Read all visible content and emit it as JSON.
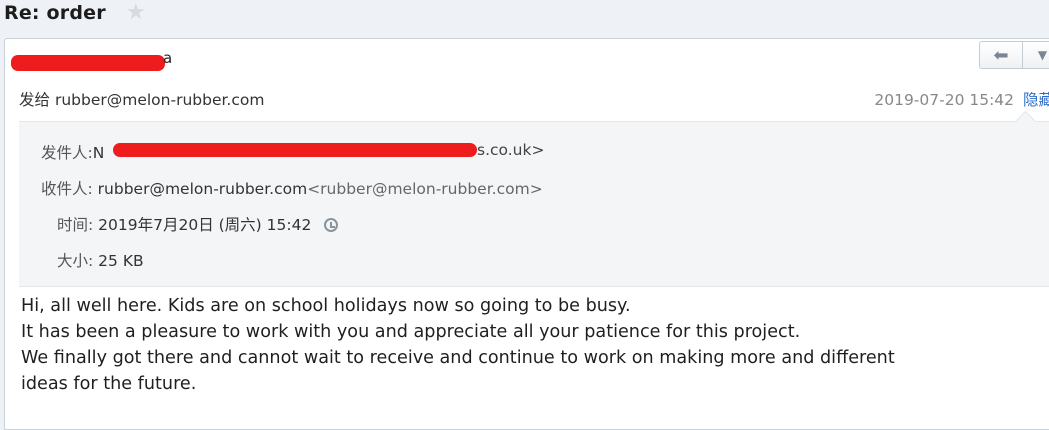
{
  "email": {
    "subject": "Re: order",
    "star_icon": "star-icon",
    "sender_visible_suffix": "a",
    "to_label": "发给",
    "to_address": "rubber@melon-rubber.com",
    "date": "2019-07-20 15:42",
    "hide_details": "隐藏信息",
    "reply_icon": "reply-icon",
    "more_icon": "chevron-down-icon"
  },
  "details": {
    "from_label": "发件人:",
    "from_visible_prefix": "N",
    "from_visible_suffix": "s.co.uk>",
    "to_label": "收件人:",
    "to_address": "rubber@melon-rubber.com",
    "to_address_full": "<rubber@melon-rubber.com>",
    "time_label": "时间:",
    "time_value": "2019年7月20日 (周六) 15:42",
    "size_label": "大小:",
    "size_value": "25 KB"
  },
  "body": {
    "lines": [
      "Hi, all well here. Kids are on school holidays now so going to be busy.",
      "It has been a pleasure to work with you and appreciate all your patience for this project.",
      "We finally got there and cannot wait to receive and continue to work on making more and different",
      "ideas for the future."
    ]
  },
  "colors": {
    "redaction": "#ee1c1c",
    "link": "#2f6ec8",
    "background": "#eef2f6"
  }
}
